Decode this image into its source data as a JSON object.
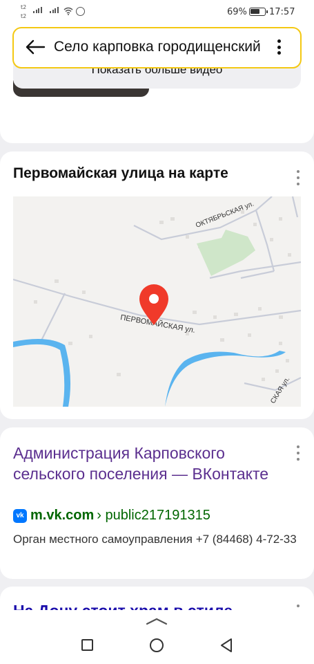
{
  "status_bar": {
    "sim1": "t2",
    "sim2": "t2",
    "battery_percent": "69%",
    "battery_level": 0.69,
    "time": "17:57"
  },
  "search": {
    "query": "Село карповка городищенский"
  },
  "video_card": {
    "show_more_label": "Показать больше видео"
  },
  "map_card": {
    "title": "Первомайская улица на карте",
    "map_labels": {
      "street_main": "ПЕРВОМАЙСКАЯ ул.",
      "street_oktyabrskaya": "ОКТЯБРЬСКАЯ ул.",
      "street_partial": "СКАЯ ул."
    },
    "colors": {
      "river": "#5ab4ef",
      "park": "#cfe6c9",
      "pin": "#f03a2a"
    }
  },
  "result_vk": {
    "title": "Администрация Карповского сельского поселения — ВКонтакте",
    "vk_badge": "vk",
    "domain": "m.vk.com",
    "path": "› public217191315",
    "description": "Орган местного самоуправления +7 (84468) 4-72-33"
  },
  "result_next": {
    "title": "На Дону стоит храм в стиле"
  },
  "colors": {
    "search_border": "#f4c812",
    "link_visited": "#5b2f8f",
    "url_green": "#006600"
  },
  "icons": [
    "back-arrow-icon",
    "more-vertical-icon",
    "map-pin-icon",
    "vk-logo-icon",
    "nav-recents-icon",
    "nav-home-icon",
    "nav-back-icon",
    "wifi-icon",
    "signal-icon",
    "whatsapp-icon",
    "battery-icon"
  ]
}
